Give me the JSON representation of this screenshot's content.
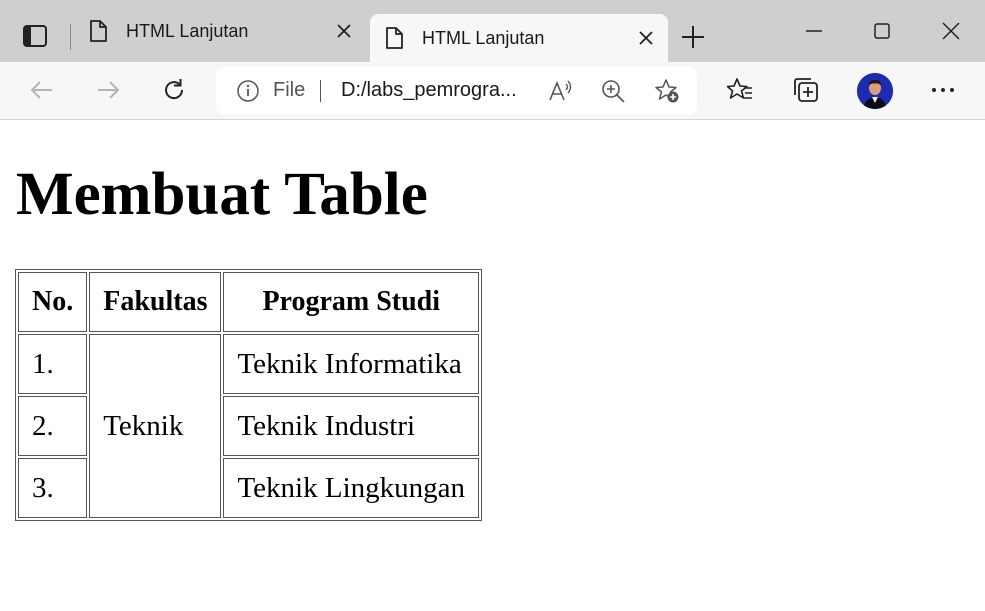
{
  "browser": {
    "tabs": [
      {
        "title": "HTML Lanjutan",
        "active": false
      },
      {
        "title": "HTML Lanjutan",
        "active": true
      }
    ],
    "address": {
      "scheme_label": "File",
      "url": "D:/labs_pemrogra..."
    }
  },
  "page": {
    "heading": "Membuat Table",
    "table": {
      "headers": [
        "No.",
        "Fakultas",
        "Program Studi"
      ],
      "rows": [
        {
          "no": "1.",
          "fakultas": "Teknik",
          "prodi": "Teknik Informatika"
        },
        {
          "no": "2.",
          "prodi": "Teknik Industri"
        },
        {
          "no": "3.",
          "prodi": "Teknik Lingkungan"
        }
      ]
    }
  },
  "colors": {
    "titlebar": "#cfcfcf",
    "toolbar": "#f7f7f7",
    "avatar": "#1e2bb0"
  }
}
